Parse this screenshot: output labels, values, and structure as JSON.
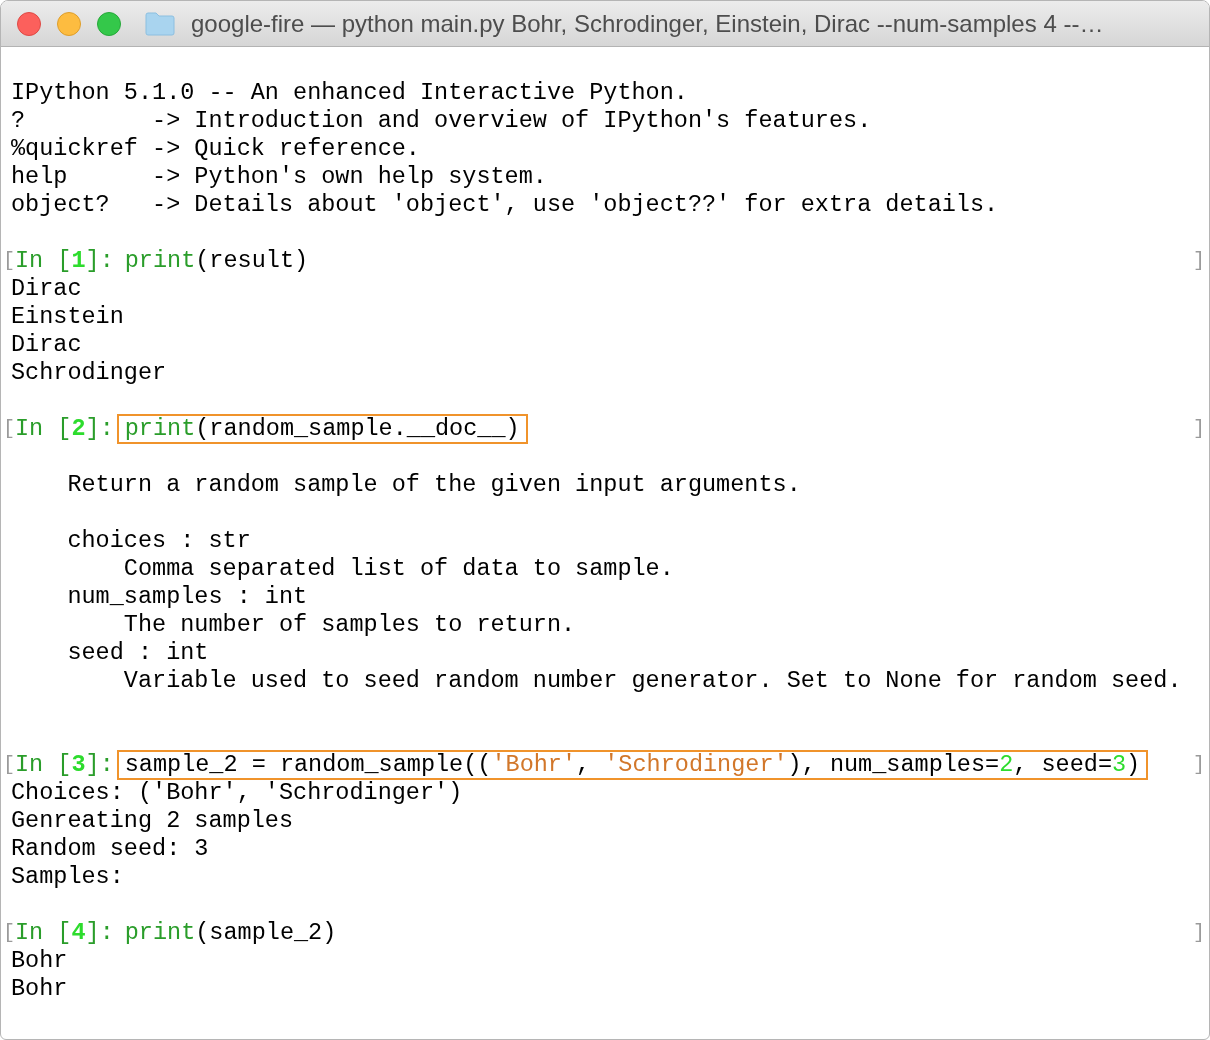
{
  "window": {
    "title": "google-fire — python main.py Bohr, Schrodinger, Einstein, Dirac --num-samples 4 --…"
  },
  "lines": [
    {
      "kind": "blank"
    },
    {
      "kind": "text",
      "text": "IPython 5.1.0 -- An enhanced Interactive Python."
    },
    {
      "kind": "text",
      "text": "?         -> Introduction and overview of IPython's features."
    },
    {
      "kind": "text",
      "text": "%quickref -> Quick reference."
    },
    {
      "kind": "text",
      "text": "help      -> Python's own help system."
    },
    {
      "kind": "text",
      "text": "object?   -> Details about 'object', use 'object??' for extra details."
    },
    {
      "kind": "blank"
    },
    {
      "kind": "prompt",
      "left_mark": "[",
      "label_open": "In [",
      "number": "1",
      "label_close": "]:",
      "highlighted": false,
      "right_mark": "]",
      "tokens": [
        {
          "kind": "builtin",
          "text": "print"
        },
        {
          "kind": "plain",
          "text": "(result)"
        }
      ]
    },
    {
      "kind": "text",
      "text": "Dirac"
    },
    {
      "kind": "text",
      "text": "Einstein"
    },
    {
      "kind": "text",
      "text": "Dirac"
    },
    {
      "kind": "text",
      "text": "Schrodinger"
    },
    {
      "kind": "blank"
    },
    {
      "kind": "prompt",
      "left_mark": "[",
      "label_open": "In [",
      "number": "2",
      "label_close": "]:",
      "highlighted": true,
      "right_mark": "]",
      "tokens": [
        {
          "kind": "builtin",
          "text": "print"
        },
        {
          "kind": "plain",
          "text": "(random_sample.__doc__)"
        }
      ]
    },
    {
      "kind": "blank"
    },
    {
      "kind": "text",
      "text": "    Return a random sample of the given input arguments."
    },
    {
      "kind": "blank"
    },
    {
      "kind": "text",
      "text": "    choices : str"
    },
    {
      "kind": "text",
      "text": "        Comma separated list of data to sample."
    },
    {
      "kind": "text",
      "text": "    num_samples : int"
    },
    {
      "kind": "text",
      "text": "        The number of samples to return."
    },
    {
      "kind": "text",
      "text": "    seed : int"
    },
    {
      "kind": "text",
      "text": "        Variable used to seed random number generator. Set to None for random seed."
    },
    {
      "kind": "blank"
    },
    {
      "kind": "blank"
    },
    {
      "kind": "prompt",
      "left_mark": "[",
      "label_open": "In [",
      "number": "3",
      "label_close": "]:",
      "highlighted": true,
      "right_mark": "]",
      "tokens": [
        {
          "kind": "plain",
          "text": "sample_2 = random_sample(("
        },
        {
          "kind": "string",
          "text": "'Bohr'"
        },
        {
          "kind": "plain",
          "text": ", "
        },
        {
          "kind": "string",
          "text": "'Schrodinger'"
        },
        {
          "kind": "plain",
          "text": "), num_samples="
        },
        {
          "kind": "number",
          "text": "2"
        },
        {
          "kind": "plain",
          "text": ", seed="
        },
        {
          "kind": "number",
          "text": "3"
        },
        {
          "kind": "plain",
          "text": ")"
        }
      ]
    },
    {
      "kind": "text",
      "text": "Choices: ('Bohr', 'Schrodinger')"
    },
    {
      "kind": "text",
      "text": "Genreating 2 samples"
    },
    {
      "kind": "text",
      "text": "Random seed: 3"
    },
    {
      "kind": "text",
      "text": "Samples:"
    },
    {
      "kind": "blank"
    },
    {
      "kind": "prompt",
      "left_mark": "[",
      "label_open": "In [",
      "number": "4",
      "label_close": "]:",
      "highlighted": false,
      "right_mark": "]",
      "tokens": [
        {
          "kind": "builtin",
          "text": "print"
        },
        {
          "kind": "plain",
          "text": "(sample_2)"
        }
      ]
    },
    {
      "kind": "text",
      "text": "Bohr"
    },
    {
      "kind": "text",
      "text": "Bohr"
    }
  ]
}
